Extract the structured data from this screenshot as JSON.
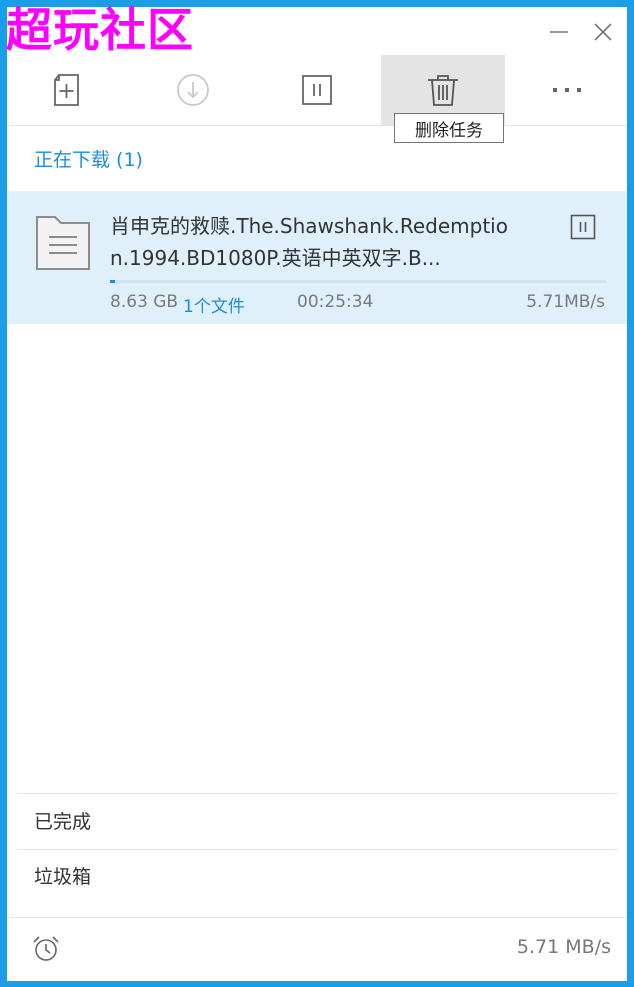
{
  "watermark": "超玩社区",
  "toolbar": {
    "tooltip": "删除任务"
  },
  "downloading": {
    "title": "正在下载 (1)",
    "task": {
      "name": "肖申克的救赎.The.Shawshank.Redemption.1994.BD1080P.英语中英双字.B...",
      "size": "8.63 GB",
      "files": "1个文件",
      "time": "00:25:34",
      "speed": "5.71MB/s",
      "progress": 0.01
    }
  },
  "nav": {
    "completed": "已完成",
    "trash": "垃圾箱"
  },
  "footer": {
    "total_speed": "5.71 MB/s"
  },
  "colors": {
    "accent": "#1b8de0",
    "task_bg": "#dff0fb",
    "frame": "#1a9ee8"
  }
}
